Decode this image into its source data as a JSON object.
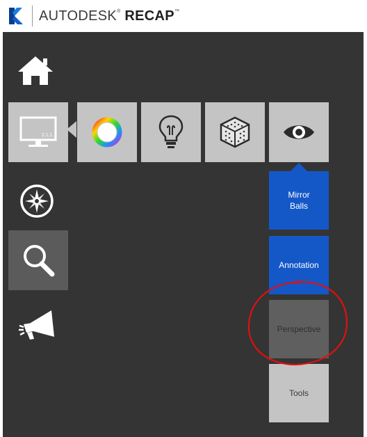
{
  "app": {
    "brand": "AUTODESK",
    "product": "RECAP"
  },
  "toolbar": {
    "display_badge": "2.1.1.1"
  },
  "menu": [
    {
      "label": "Mirror\nBalls",
      "state": "active"
    },
    {
      "label": "Annotation",
      "state": "active"
    },
    {
      "label": "Perspective",
      "state": "disabled"
    },
    {
      "label": "Tools",
      "state": "normal"
    }
  ],
  "icons": {
    "home": "home-icon",
    "display": "monitor-icon",
    "color": "color-wheel-icon",
    "lighting": "lightbulb-icon",
    "point_cloud": "cube-icon",
    "view": "eye-icon",
    "navigate": "compass-icon",
    "search": "magnifier-icon",
    "announce": "megaphone-icon"
  },
  "colors": {
    "panel": "#343434",
    "tile": "#c4c4c4",
    "tile_selected_dark": "#5b5b5b",
    "accent_blue": "#1458c8",
    "annotation_red": "#e01010"
  }
}
